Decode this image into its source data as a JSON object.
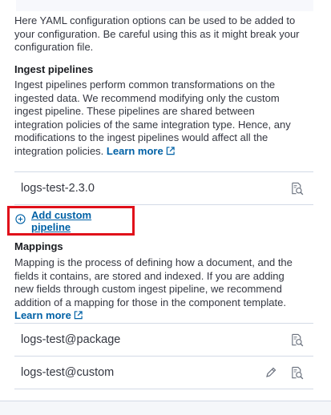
{
  "yaml": {
    "description": "Here YAML configuration options can be used to be added to your configuration. Be careful using this as it might break your configuration file."
  },
  "ingest": {
    "title": "Ingest pipelines",
    "description": "Ingest pipelines perform common transformations on the ingested data. We recommend modifying only the custom ingest pipeline. These pipelines are shared between integration policies of the same integration type. Hence, any modifications to the ingest pipelines would affect all the integration policies.",
    "learn_more": "Learn more",
    "pipelines": [
      {
        "name": "logs-test-2.3.0"
      }
    ],
    "add_custom": "Add custom pipeline"
  },
  "mappings": {
    "title": "Mappings",
    "description": "Mapping is the process of defining how a document, and the fields it contains, are stored and indexed. If you are adding new fields through custom ingest pipeline, we recommend addition of a mapping for those in the component template.",
    "learn_more": "Learn more",
    "templates": [
      {
        "name": "logs-test@package"
      },
      {
        "name": "logs-test@custom"
      }
    ]
  },
  "colors": {
    "link": "#0061a6",
    "highlight_border": "#e0101a",
    "divider": "#d3dae6"
  },
  "icons": {
    "inspect": "inspect-icon",
    "edit": "pencil-icon",
    "external": "external-link-icon",
    "add": "plus-in-circle-icon"
  }
}
